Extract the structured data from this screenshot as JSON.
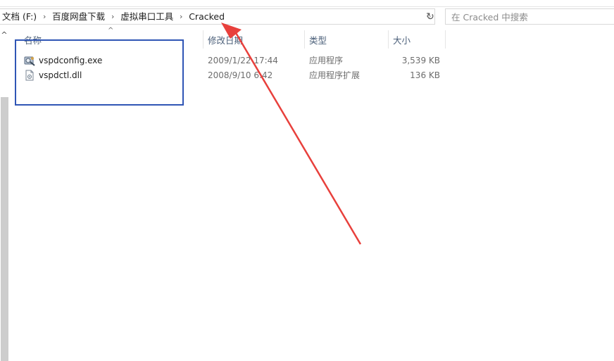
{
  "address": {
    "crumbs": [
      "文档 (F:)",
      "百度网盘下载",
      "虚拟串口工具",
      "Cracked"
    ],
    "separator": "›",
    "dropdown": "⌵",
    "refresh": "↻"
  },
  "search": {
    "placeholder": "在 Cracked 中搜索"
  },
  "nav": {
    "up_glyph": "^"
  },
  "columns": {
    "sort_glyph": "^",
    "name": "名称",
    "date": "修改日期",
    "type": "类型",
    "size": "大小"
  },
  "files": [
    {
      "name": "vspdconfig.exe",
      "date": "2009/1/22 17:44",
      "type": "应用程序",
      "size": "3,539 KB",
      "icon": "exe-icon"
    },
    {
      "name": "vspdctl.dll",
      "date": "2008/9/10 6:42",
      "type": "应用程序扩展",
      "size": "136 KB",
      "icon": "dll-icon"
    }
  ],
  "colors": {
    "annotation_box": "#2f55b5",
    "annotation_arrow": "#e8403c",
    "header_text": "#4c607a"
  }
}
